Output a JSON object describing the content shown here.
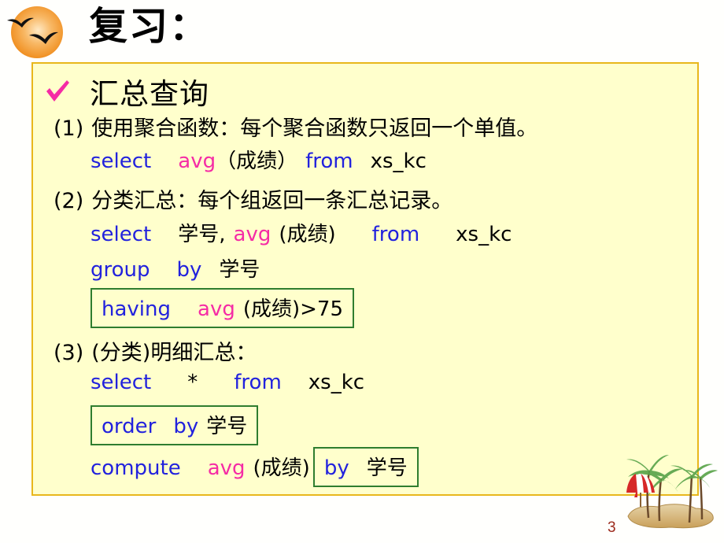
{
  "slide": {
    "title": "复习：",
    "page_number": "3",
    "colors": {
      "panel_background": "#ffffcc",
      "panel_border": "#e8b71c",
      "page_background": "#fffffd",
      "keyword": "#2222dd",
      "function": "#f52ba5",
      "box_border": "#2f7d2f",
      "check": "#f52ba5",
      "sun": "#f5a233",
      "page_number": "#9c2a1c"
    }
  },
  "heading": {
    "check_icon": "check-icon",
    "text": "汇总查询"
  },
  "items": [
    {
      "number": "(1)",
      "description": "使用聚合函数：每个聚合函数只返回一个单值。",
      "code": {
        "select": "select",
        "avg": "avg",
        "arg": "（成绩）",
        "from": "from",
        "table": "xs_kc"
      }
    },
    {
      "number": "(2)",
      "description": "分类汇总：每个组返回一条汇总记录。",
      "code": {
        "select": "select",
        "column": "学号,",
        "avg": "avg",
        "arg": "(成绩)",
        "from": "from",
        "table": "xs_kc",
        "group": "group",
        "by": "by",
        "group_column": "学号",
        "having": "having",
        "having_avg": "avg",
        "having_arg": "(成绩)",
        "having_condition": ">75"
      }
    },
    {
      "number": "(3)",
      "description": "(分类)明细汇总：",
      "code": {
        "select": "select",
        "star": "*",
        "from": "from",
        "table": "xs_kc",
        "order": "order",
        "order_by": "by",
        "order_column": "学号",
        "compute": "compute",
        "compute_avg": "avg",
        "compute_arg": "(成绩)",
        "compute_by": "by",
        "compute_by_column": "学号"
      }
    }
  ],
  "decorations": {
    "sun": "sun-icon",
    "birds": "bird-icon",
    "beach": "palm-beach-icon",
    "umbrella": "beach-umbrella-icon"
  }
}
